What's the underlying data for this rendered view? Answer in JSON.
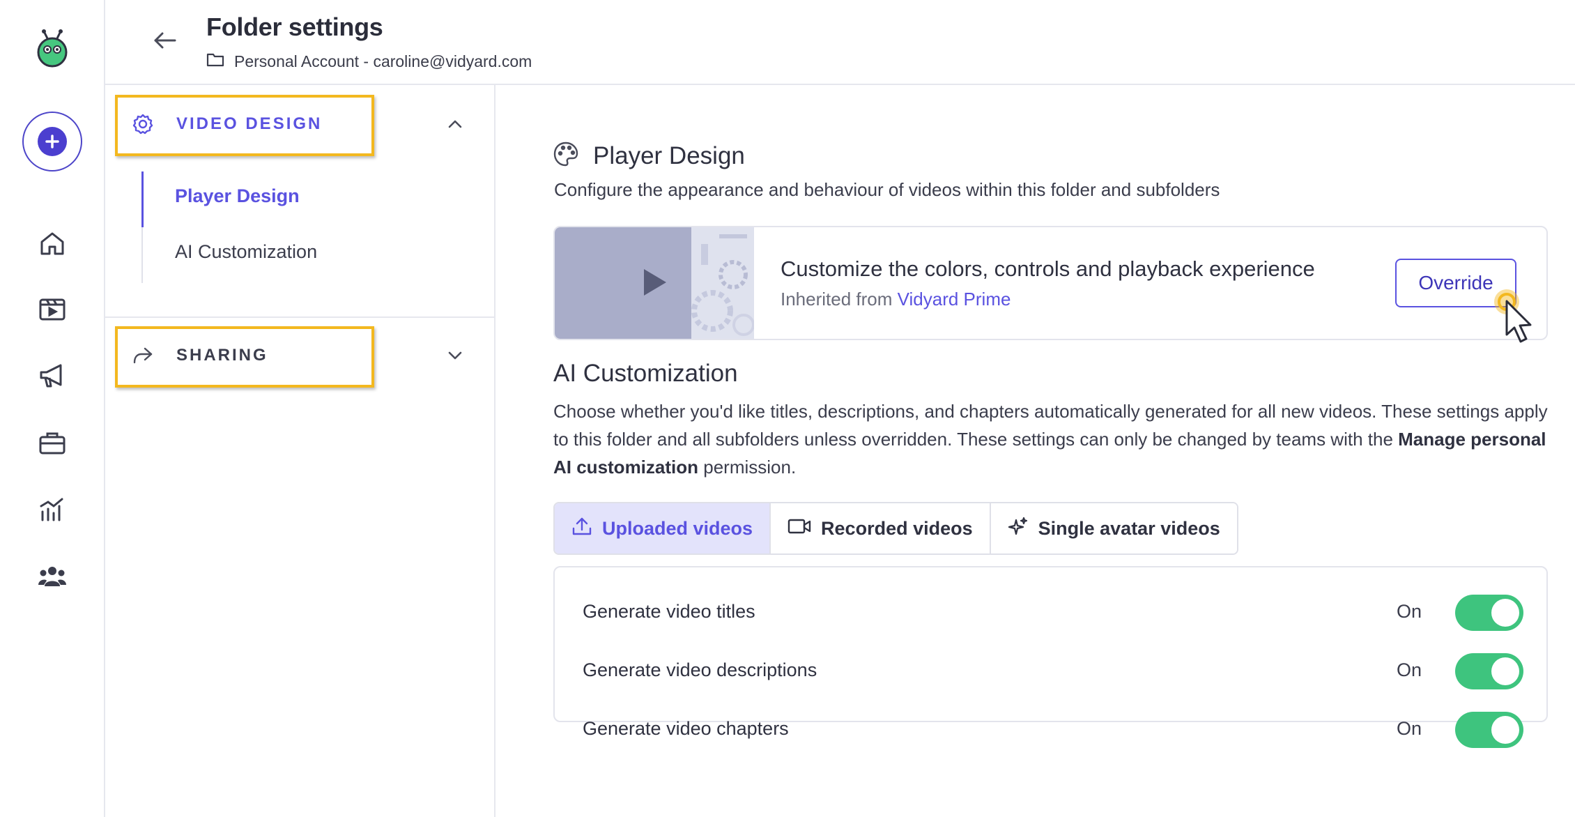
{
  "header": {
    "title": "Folder settings",
    "account": "Personal Account - caroline@vidyard.com"
  },
  "rail": {
    "icons": [
      "vidyard-logo-icon",
      "create-plus-icon",
      "home-icon",
      "videos-icon",
      "campaigns-icon",
      "briefcase-icon",
      "analytics-icon",
      "team-icon"
    ]
  },
  "nav": {
    "video_design": {
      "label": "VIDEO DESIGN",
      "items": [
        "Player Design",
        "AI Customization"
      ],
      "active_item": "Player Design"
    },
    "sharing": {
      "label": "SHARING"
    }
  },
  "player_design": {
    "title": "Player Design",
    "description": "Configure the appearance and behaviour of videos within this folder and subfolders",
    "card_title": "Customize the colors, controls and playback experience",
    "inherited_prefix": "Inherited from",
    "inherited_source": "Vidyard Prime",
    "override_label": "Override"
  },
  "ai_customization": {
    "title": "AI Customization",
    "desc_part1": "Choose whether you'd like titles, descriptions, and chapters automatically generated for all new videos. These settings apply to this folder and all subfolders unless overridden. These settings can only be changed by teams with the",
    "desc_bold": "Manage personal AI customization",
    "desc_part2": "permission.",
    "tabs": [
      {
        "label": "Uploaded videos",
        "active": true
      },
      {
        "label": "Recorded videos",
        "active": false
      },
      {
        "label": "Single avatar videos",
        "active": false
      }
    ],
    "toggles": [
      {
        "label": "Generate video titles",
        "state": "On",
        "on": true
      },
      {
        "label": "Generate video descriptions",
        "state": "On",
        "on": true
      },
      {
        "label": "Generate video chapters",
        "state": "On",
        "on": true
      }
    ]
  },
  "colors": {
    "accent": "#5a52e0",
    "toggle_on": "#3ec47e",
    "highlight": "#f3b81f"
  }
}
